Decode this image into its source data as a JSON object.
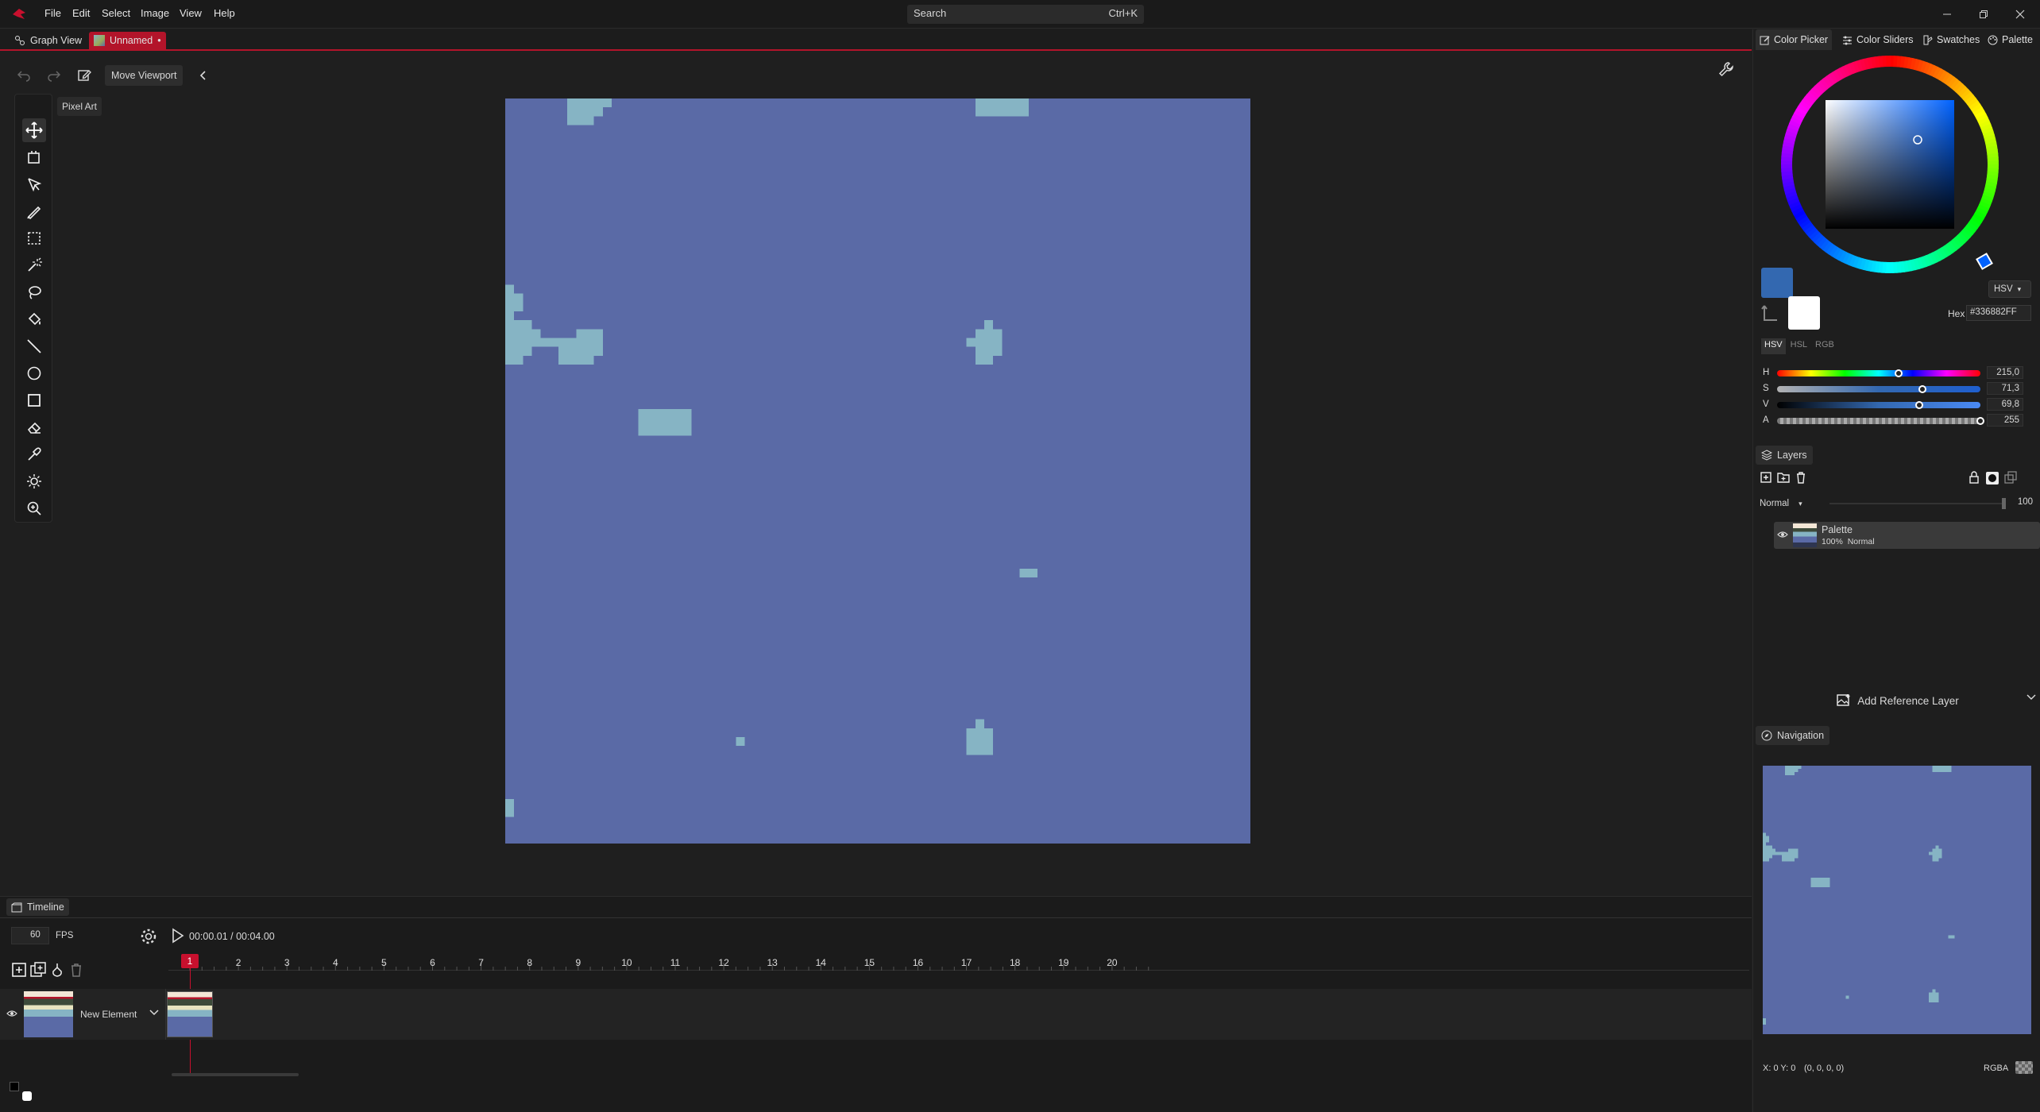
{
  "titlebar": {
    "menus": [
      "File",
      "Edit",
      "Select",
      "Image",
      "View",
      "Help"
    ],
    "search_placeholder": "Search",
    "search_shortcut": "Ctrl+K"
  },
  "tabs": {
    "graph_view": "Graph View",
    "document": "Unnamed",
    "document_modified": "•"
  },
  "toolbar": {
    "move_viewport": "Move Viewport",
    "tool_group_tooltip": "Pixel Art"
  },
  "tools": [
    "move-tool",
    "crop-tool",
    "select-pointer-tool",
    "pen-tool",
    "rectangle-select-tool",
    "magic-wand-tool",
    "lasso-tool",
    "paint-bucket-tool",
    "line-tool",
    "ellipse-tool",
    "rectangle-tool",
    "eraser-tool",
    "eyedropper-tool",
    "brightness-tool",
    "zoom-tool"
  ],
  "right_panel": {
    "tabs": [
      "Color Picker",
      "Color Sliders",
      "Swatches",
      "Palette"
    ],
    "color_mode": "HSV",
    "hex_label": "Hex",
    "hex_value": "#336882FF",
    "primary_color": "#3368b0",
    "secondary_color": "#ffffff",
    "slider_modes": [
      "HSV",
      "HSL",
      "RGB"
    ],
    "sliders": [
      {
        "label": "H",
        "value": "215,0",
        "fraction": 0.597
      },
      {
        "label": "S",
        "value": "71,3",
        "fraction": 0.713
      },
      {
        "label": "V",
        "value": "69,8",
        "fraction": 0.698
      },
      {
        "label": "A",
        "value": "255",
        "fraction": 1.0
      }
    ],
    "layers": {
      "title": "Layers",
      "blend_mode": "Normal",
      "opacity": "100",
      "items": [
        {
          "name": "Palette",
          "meta": "100%  Normal"
        }
      ]
    },
    "add_reference_layer": "Add Reference Layer",
    "navigation_title": "Navigation",
    "status": {
      "coords": "X: 0 Y: 0",
      "color": "(0, 0, 0, 0)",
      "format": "RGBA"
    }
  },
  "timeline": {
    "title": "Timeline",
    "fps": "60",
    "fps_label": "FPS",
    "time": "00:00.01 / 00:04.00",
    "frames": [
      "1",
      "2",
      "3",
      "4",
      "5",
      "6",
      "7",
      "8",
      "9",
      "10",
      "11",
      "12",
      "13",
      "14",
      "15",
      "16",
      "17",
      "18",
      "19",
      "20"
    ],
    "current_frame": "1",
    "track_name": "New Element"
  },
  "colors": {
    "accent": "#b3142a",
    "water_deep": "#5a6aa6",
    "water_shallow": "#86b4c4",
    "sand": "#f6e800",
    "grass_light": "#9aaa58",
    "grass": "#6a8a4c",
    "forest": "#465a3e",
    "forest_dark": "#35473a",
    "rock": "#a8a8a8"
  }
}
